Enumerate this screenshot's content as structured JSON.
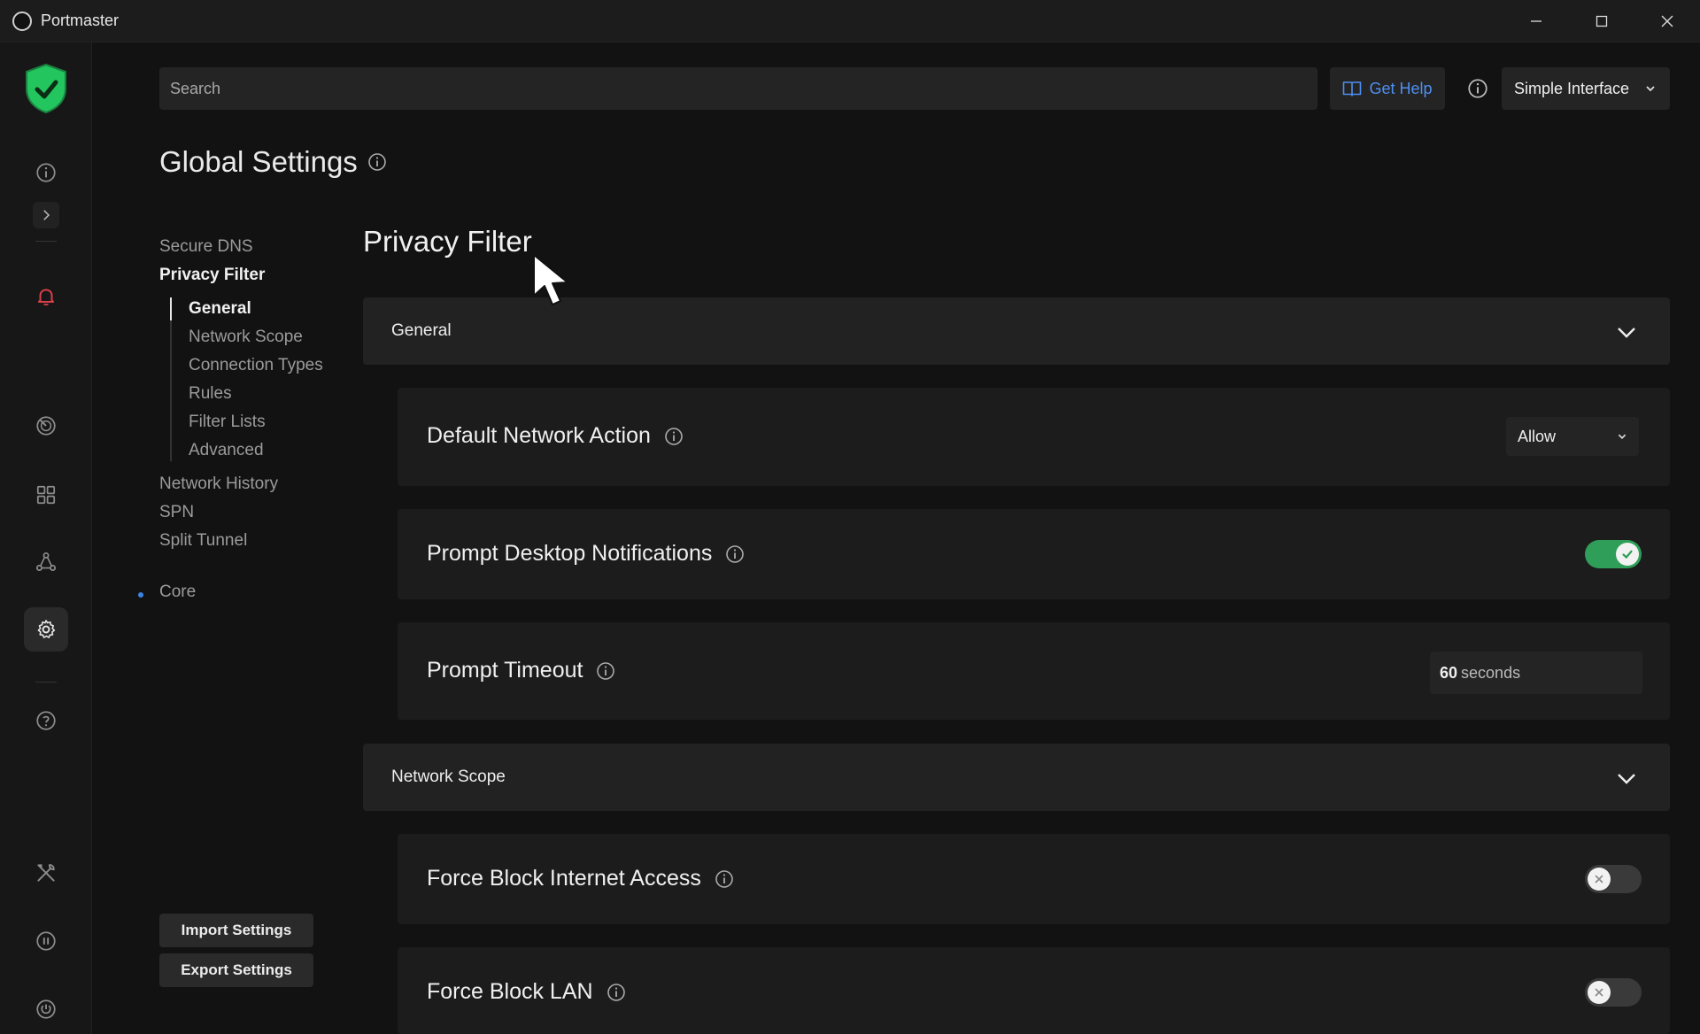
{
  "window": {
    "title": "Portmaster",
    "minimize": "—",
    "maximize": "☐",
    "close": "✕"
  },
  "search": {
    "placeholder": "Search"
  },
  "topbar": {
    "help_label": "Get Help",
    "interface_label": "Simple Interface"
  },
  "page": {
    "title": "Global Settings"
  },
  "nav": {
    "items": [
      {
        "label": "Secure DNS"
      },
      {
        "label": "Privacy Filter"
      },
      {
        "label": "Network History"
      },
      {
        "label": "SPN"
      },
      {
        "label": "Split Tunnel"
      },
      {
        "label": "Core"
      }
    ],
    "sub_items": [
      {
        "label": "General"
      },
      {
        "label": "Network Scope"
      },
      {
        "label": "Connection Types"
      },
      {
        "label": "Rules"
      },
      {
        "label": "Filter Lists"
      },
      {
        "label": "Advanced"
      }
    ],
    "import_label": "Import Settings",
    "export_label": "Export Settings"
  },
  "content": {
    "title": "Privacy Filter",
    "sections": [
      {
        "title": "General"
      },
      {
        "title": "Network Scope"
      }
    ],
    "settings": {
      "default_network_action": {
        "label": "Default Network Action",
        "value": "Allow"
      },
      "prompt_desktop_notifications": {
        "label": "Prompt Desktop Notifications",
        "enabled": true
      },
      "prompt_timeout": {
        "label": "Prompt Timeout",
        "value": "60",
        "unit": "seconds"
      },
      "force_block_internet": {
        "label": "Force Block Internet Access",
        "enabled": false
      },
      "force_block_lan": {
        "label": "Force Block LAN",
        "enabled": false
      }
    }
  },
  "colors": {
    "accent_blue": "#4f8ff0",
    "toggle_on": "#2f9e59",
    "shield_green": "#22c55e",
    "alert_red": "#e0404a"
  },
  "icons": {
    "rail": [
      "shield-check-icon",
      "info-icon",
      "chevron-right-icon",
      "bell-icon",
      "radar-icon",
      "apps-grid-icon",
      "network-icon",
      "gear-icon",
      "help-icon",
      "tools-icon",
      "pause-icon",
      "power-icon"
    ]
  }
}
